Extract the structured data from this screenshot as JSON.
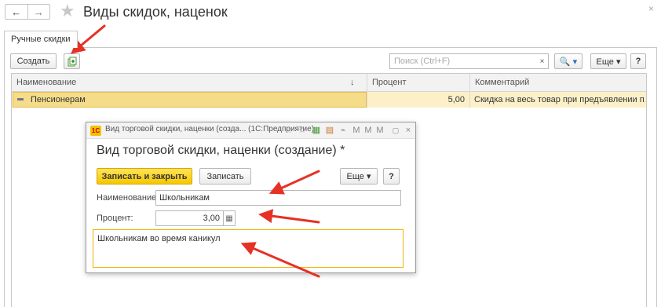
{
  "window": {
    "title": "Виды скидок, наценок"
  },
  "nav": {
    "back": "←",
    "forward": "→",
    "star": "★",
    "close": "×"
  },
  "tabs": [
    {
      "label": "Ручные скидки"
    }
  ],
  "toolbar": {
    "create_label": "Создать",
    "search_placeholder": "Поиск (Ctrl+F)",
    "search_clear": "×",
    "find_label": "🔍 ▾",
    "more_label": "Еще ▾",
    "help_label": "?"
  },
  "table": {
    "columns": [
      {
        "label": "Наименование",
        "sort": "↓"
      },
      {
        "label": "Процент"
      },
      {
        "label": "Комментарий"
      }
    ],
    "rows": [
      {
        "name": "Пенсионерам",
        "percent": "5,00",
        "comment": "Скидка на весь товар при предъявлении п..."
      }
    ]
  },
  "dialog": {
    "window_title": "Вид торговой скидки, наценки (созда... (1С:Предприятие)",
    "logo": "1С",
    "heading": "Вид торговой скидки, наценки (создание) *",
    "save_close_label": "Записать и закрыть",
    "save_label": "Записать",
    "more_label": "Еще ▾",
    "help_label": "?",
    "name_label": "Наименование:",
    "name_value": "Школьникам",
    "percent_label": "Процент:",
    "percent_value": "3,00",
    "comment_value": "Школьникам во время каникул"
  },
  "colors": {
    "accent": "#f6c700",
    "selection": "#f5dc8b",
    "annotation_arrow": "#e53225"
  }
}
